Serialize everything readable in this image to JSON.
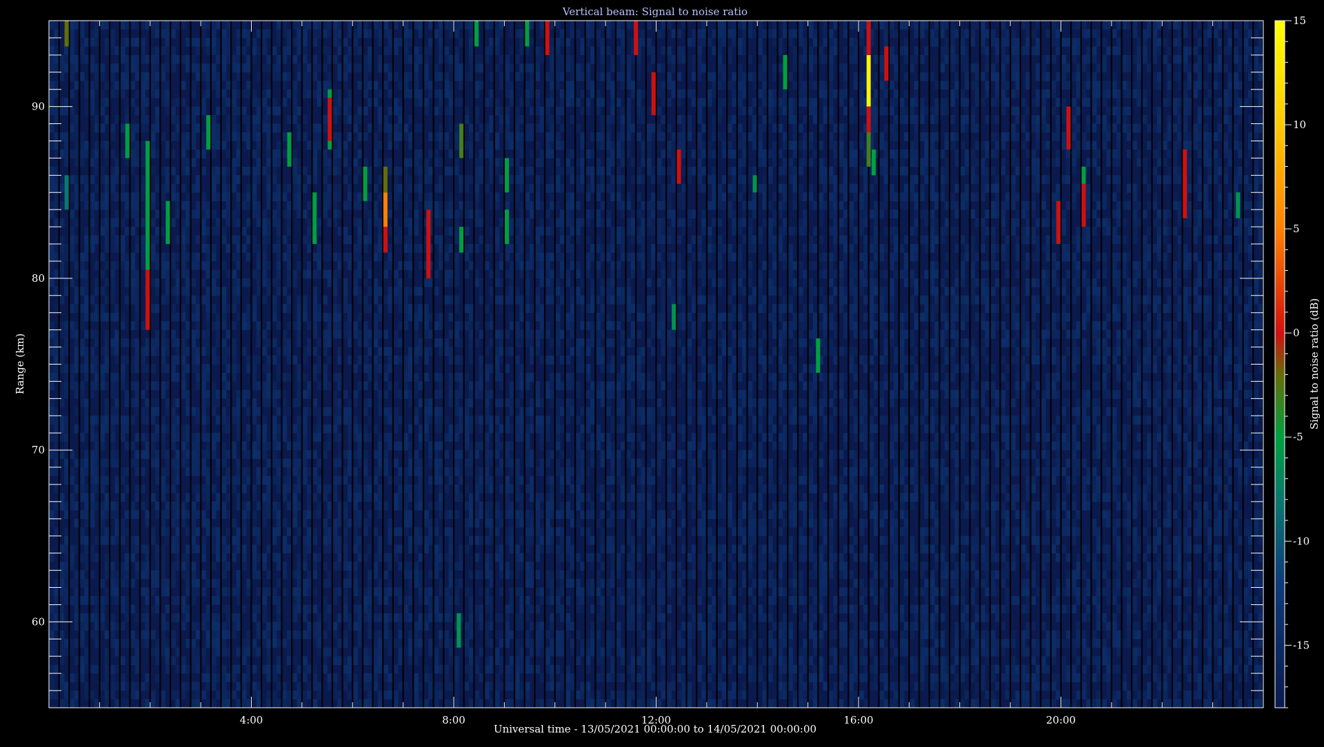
{
  "colors": {
    "background": "#000000",
    "frame": "#ffffff",
    "title_text": "#b8c4ff",
    "axis_text": "#ffffff",
    "noise_base": "#0b1a4e",
    "colormap": [
      "#0b1a4e",
      "#0e3a7a",
      "#0b7a6a",
      "#00a040",
      "#6a6a00",
      "#d01010",
      "#ff8000",
      "#ffff00"
    ]
  },
  "chart_data": {
    "type": "heatmap",
    "title": "Vertical beam: Signal to noise ratio",
    "xlabel": "Universal time - 13/05/2021 00:00:00 to 14/05/2021 00:00:00",
    "ylabel": "Range (km)",
    "colorbar_label": "Signal to noise ratio (dB)",
    "x_units": "hours UT",
    "xlim": [
      0,
      24
    ],
    "ylim": [
      55,
      95
    ],
    "clim": [
      -18,
      15
    ],
    "x_ticks": [
      {
        "value": 4,
        "label": "4:00"
      },
      {
        "value": 8,
        "label": "8:00"
      },
      {
        "value": 12,
        "label": "12:00"
      },
      {
        "value": 16,
        "label": "16:00"
      },
      {
        "value": 20,
        "label": "20:00"
      }
    ],
    "y_ticks": [
      {
        "value": 60,
        "label": "60"
      },
      {
        "value": 70,
        "label": "70"
      },
      {
        "value": 80,
        "label": "80"
      },
      {
        "value": 90,
        "label": "90"
      }
    ],
    "colorbar_ticks": [
      {
        "value": 15,
        "label": "15"
      },
      {
        "value": 10,
        "label": "10"
      },
      {
        "value": 5,
        "label": "5"
      },
      {
        "value": 0,
        "label": "0"
      },
      {
        "value": -5,
        "label": "-5"
      },
      {
        "value": -10,
        "label": "-10"
      },
      {
        "value": -15,
        "label": "-15"
      }
    ],
    "x_minor_step_hours": 1,
    "y_minor_step_km": 1,
    "colorbar_minor_step_db": 1,
    "background_snr_db": -17,
    "echoes": [
      {
        "t": 0.35,
        "r0": 93.5,
        "r1": 95.0,
        "snr": -2
      },
      {
        "t": 0.35,
        "r0": 84.0,
        "r1": 86.0,
        "snr": -8
      },
      {
        "t": 1.55,
        "r0": 87.0,
        "r1": 89.0,
        "snr": -5
      },
      {
        "t": 1.95,
        "r0": 77.0,
        "r1": 80.5,
        "snr": 0
      },
      {
        "t": 1.95,
        "r0": 80.5,
        "r1": 88.0,
        "snr": -5
      },
      {
        "t": 2.35,
        "r0": 82.0,
        "r1": 84.5,
        "snr": -5
      },
      {
        "t": 3.15,
        "r0": 87.5,
        "r1": 89.5,
        "snr": -5
      },
      {
        "t": 4.75,
        "r0": 86.5,
        "r1": 88.5,
        "snr": -5
      },
      {
        "t": 5.25,
        "r0": 82.0,
        "r1": 85.0,
        "snr": -5
      },
      {
        "t": 5.55,
        "r0": 88.0,
        "r1": 90.5,
        "snr": 0
      },
      {
        "t": 5.55,
        "r0": 87.5,
        "r1": 88.0,
        "snr": -5
      },
      {
        "t": 5.55,
        "r0": 90.5,
        "r1": 91.0,
        "snr": -5
      },
      {
        "t": 6.25,
        "r0": 84.5,
        "r1": 86.5,
        "snr": -5
      },
      {
        "t": 6.65,
        "r0": 81.5,
        "r1": 83.0,
        "snr": 0
      },
      {
        "t": 6.65,
        "r0": 83.0,
        "r1": 85.0,
        "snr": 5
      },
      {
        "t": 6.65,
        "r0": 85.0,
        "r1": 86.5,
        "snr": -2
      },
      {
        "t": 7.5,
        "r0": 80.0,
        "r1": 84.0,
        "snr": 0
      },
      {
        "t": 8.15,
        "r0": 81.5,
        "r1": 83.0,
        "snr": -5
      },
      {
        "t": 8.15,
        "r0": 87.0,
        "r1": 89.0,
        "snr": -3
      },
      {
        "t": 8.1,
        "r0": 58.5,
        "r1": 60.5,
        "snr": -6
      },
      {
        "t": 8.45,
        "r0": 93.5,
        "r1": 95.0,
        "snr": -5
      },
      {
        "t": 9.05,
        "r0": 82.0,
        "r1": 84.0,
        "snr": -5
      },
      {
        "t": 9.05,
        "r0": 85.0,
        "r1": 87.0,
        "snr": -5
      },
      {
        "t": 9.45,
        "r0": 93.5,
        "r1": 95.0,
        "snr": -5
      },
      {
        "t": 9.85,
        "r0": 93.0,
        "r1": 95.0,
        "snr": 0
      },
      {
        "t": 11.6,
        "r0": 93.0,
        "r1": 95.0,
        "snr": 0
      },
      {
        "t": 11.95,
        "r0": 89.5,
        "r1": 92.0,
        "snr": 0
      },
      {
        "t": 12.35,
        "r0": 77.0,
        "r1": 78.5,
        "snr": -6
      },
      {
        "t": 12.45,
        "r0": 85.5,
        "r1": 87.5,
        "snr": 0
      },
      {
        "t": 13.95,
        "r0": 85.0,
        "r1": 86.0,
        "snr": -6
      },
      {
        "t": 14.55,
        "r0": 91.0,
        "r1": 93.0,
        "snr": -5
      },
      {
        "t": 15.2,
        "r0": 74.5,
        "r1": 76.5,
        "snr": -5
      },
      {
        "t": 16.2,
        "r0": 90.0,
        "r1": 93.0,
        "snr": 14
      },
      {
        "t": 16.2,
        "r0": 93.0,
        "r1": 95.0,
        "snr": 0
      },
      {
        "t": 16.2,
        "r0": 88.5,
        "r1": 90.0,
        "snr": 0
      },
      {
        "t": 16.2,
        "r0": 86.5,
        "r1": 88.5,
        "snr": -3
      },
      {
        "t": 16.3,
        "r0": 86.0,
        "r1": 87.5,
        "snr": -5
      },
      {
        "t": 16.55,
        "r0": 91.5,
        "r1": 93.5,
        "snr": 0
      },
      {
        "t": 19.95,
        "r0": 82.0,
        "r1": 84.5,
        "snr": 0
      },
      {
        "t": 20.15,
        "r0": 87.5,
        "r1": 90.0,
        "snr": 0
      },
      {
        "t": 20.45,
        "r0": 83.0,
        "r1": 86.0,
        "snr": 0
      },
      {
        "t": 20.45,
        "r0": 85.5,
        "r1": 86.5,
        "snr": -5
      },
      {
        "t": 22.45,
        "r0": 83.5,
        "r1": 87.5,
        "snr": 0
      },
      {
        "t": 23.5,
        "r0": 83.5,
        "r1": 85.0,
        "snr": -6
      }
    ]
  }
}
